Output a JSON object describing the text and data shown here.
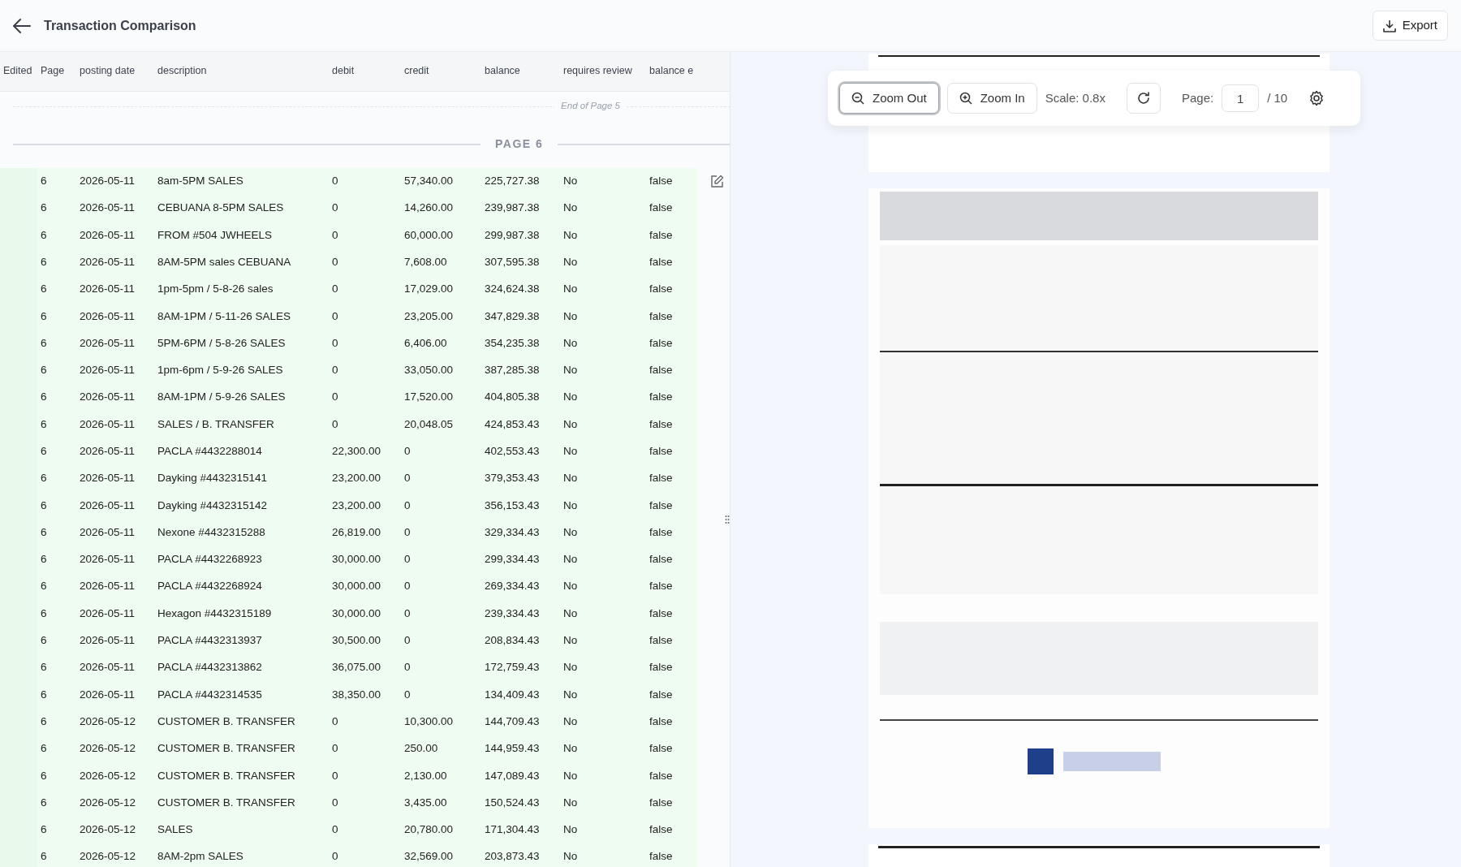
{
  "header": {
    "title": "Transaction Comparison",
    "export_label": "Export"
  },
  "table": {
    "columns": [
      "Edited",
      "Page",
      "posting date",
      "description",
      "debit",
      "credit",
      "balance",
      "requires review",
      "balance e"
    ],
    "end_marker": "End of Page 5",
    "page_divider": "PAGE 6",
    "rows": [
      {
        "page": "6",
        "posting_date": "2026-05-11",
        "description": "8am-5PM SALES",
        "debit": "0",
        "credit": "57,340.00",
        "balance": "225,727.38",
        "requires_review": "No",
        "balance_error": "false",
        "matched": true,
        "hovered": true
      },
      {
        "page": "6",
        "posting_date": "2026-05-11",
        "description": "CEBUANA 8-5PM SALES",
        "debit": "0",
        "credit": "14,260.00",
        "balance": "239,987.38",
        "requires_review": "No",
        "balance_error": "false",
        "matched": true,
        "hovered": false
      },
      {
        "page": "6",
        "posting_date": "2026-05-11",
        "description": "FROM #504 JWHEELS",
        "debit": "0",
        "credit": "60,000.00",
        "balance": "299,987.38",
        "requires_review": "No",
        "balance_error": "false",
        "matched": true,
        "hovered": false
      },
      {
        "page": "6",
        "posting_date": "2026-05-11",
        "description": "8AM-5PM sales CEBUANA",
        "debit": "0",
        "credit": "7,608.00",
        "balance": "307,595.38",
        "requires_review": "No",
        "balance_error": "false",
        "matched": true,
        "hovered": false
      },
      {
        "page": "6",
        "posting_date": "2026-05-11",
        "description": "1pm-5pm / 5-8-26 sales",
        "debit": "0",
        "credit": "17,029.00",
        "balance": "324,624.38",
        "requires_review": "No",
        "balance_error": "false",
        "matched": true,
        "hovered": false
      },
      {
        "page": "6",
        "posting_date": "2026-05-11",
        "description": "8AM-1PM / 5-11-26 SALES",
        "debit": "0",
        "credit": "23,205.00",
        "balance": "347,829.38",
        "requires_review": "No",
        "balance_error": "false",
        "matched": true,
        "hovered": false
      },
      {
        "page": "6",
        "posting_date": "2026-05-11",
        "description": "5PM-6PM / 5-8-26 SALES",
        "debit": "0",
        "credit": "6,406.00",
        "balance": "354,235.38",
        "requires_review": "No",
        "balance_error": "false",
        "matched": true,
        "hovered": false
      },
      {
        "page": "6",
        "posting_date": "2026-05-11",
        "description": "1pm-6pm / 5-9-26 SALES",
        "debit": "0",
        "credit": "33,050.00",
        "balance": "387,285.38",
        "requires_review": "No",
        "balance_error": "false",
        "matched": true,
        "hovered": false
      },
      {
        "page": "6",
        "posting_date": "2026-05-11",
        "description": "8AM-1PM / 5-9-26 SALES",
        "debit": "0",
        "credit": "17,520.00",
        "balance": "404,805.38",
        "requires_review": "No",
        "balance_error": "false",
        "matched": true,
        "hovered": false
      },
      {
        "page": "6",
        "posting_date": "2026-05-11",
        "description": "SALES / B. TRANSFER",
        "debit": "0",
        "credit": "20,048.05",
        "balance": "424,853.43",
        "requires_review": "No",
        "balance_error": "false",
        "matched": true,
        "hovered": false
      },
      {
        "page": "6",
        "posting_date": "2026-05-11",
        "description": "PACLA #4432288014",
        "debit": "22,300.00",
        "credit": "0",
        "balance": "402,553.43",
        "requires_review": "No",
        "balance_error": "false",
        "matched": true,
        "hovered": false
      },
      {
        "page": "6",
        "posting_date": "2026-05-11",
        "description": "Dayking #4432315141",
        "debit": "23,200.00",
        "credit": "0",
        "balance": "379,353.43",
        "requires_review": "No",
        "balance_error": "false",
        "matched": true,
        "hovered": false
      },
      {
        "page": "6",
        "posting_date": "2026-05-11",
        "description": "Dayking #4432315142",
        "debit": "23,200.00",
        "credit": "0",
        "balance": "356,153.43",
        "requires_review": "No",
        "balance_error": "false",
        "matched": true,
        "hovered": false
      },
      {
        "page": "6",
        "posting_date": "2026-05-11",
        "description": "Nexone #4432315288",
        "debit": "26,819.00",
        "credit": "0",
        "balance": "329,334.43",
        "requires_review": "No",
        "balance_error": "false",
        "matched": true,
        "hovered": false
      },
      {
        "page": "6",
        "posting_date": "2026-05-11",
        "description": "PACLA #4432268923",
        "debit": "30,000.00",
        "credit": "0",
        "balance": "299,334.43",
        "requires_review": "No",
        "balance_error": "false",
        "matched": true,
        "hovered": false
      },
      {
        "page": "6",
        "posting_date": "2026-05-11",
        "description": "PACLA #4432268924",
        "debit": "30,000.00",
        "credit": "0",
        "balance": "269,334.43",
        "requires_review": "No",
        "balance_error": "false",
        "matched": true,
        "hovered": false
      },
      {
        "page": "6",
        "posting_date": "2026-05-11",
        "description": "Hexagon #4432315189",
        "debit": "30,000.00",
        "credit": "0",
        "balance": "239,334.43",
        "requires_review": "No",
        "balance_error": "false",
        "matched": true,
        "hovered": false
      },
      {
        "page": "6",
        "posting_date": "2026-05-11",
        "description": "PACLA #4432313937",
        "debit": "30,500.00",
        "credit": "0",
        "balance": "208,834.43",
        "requires_review": "No",
        "balance_error": "false",
        "matched": true,
        "hovered": false
      },
      {
        "page": "6",
        "posting_date": "2026-05-11",
        "description": "PACLA #4432313862",
        "debit": "36,075.00",
        "credit": "0",
        "balance": "172,759.43",
        "requires_review": "No",
        "balance_error": "false",
        "matched": true,
        "hovered": false
      },
      {
        "page": "6",
        "posting_date": "2026-05-11",
        "description": "PACLA #4432314535",
        "debit": "38,350.00",
        "credit": "0",
        "balance": "134,409.43",
        "requires_review": "No",
        "balance_error": "false",
        "matched": true,
        "hovered": false
      },
      {
        "page": "6",
        "posting_date": "2026-05-12",
        "description": "CUSTOMER B. TRANSFER",
        "debit": "0",
        "credit": "10,300.00",
        "balance": "144,709.43",
        "requires_review": "No",
        "balance_error": "false",
        "matched": true,
        "hovered": false
      },
      {
        "page": "6",
        "posting_date": "2026-05-12",
        "description": "CUSTOMER B. TRANSFER",
        "debit": "0",
        "credit": "250.00",
        "balance": "144,959.43",
        "requires_review": "No",
        "balance_error": "false",
        "matched": true,
        "hovered": false
      },
      {
        "page": "6",
        "posting_date": "2026-05-12",
        "description": "CUSTOMER B. TRANSFER",
        "debit": "0",
        "credit": "2,130.00",
        "balance": "147,089.43",
        "requires_review": "No",
        "balance_error": "false",
        "matched": true,
        "hovered": false
      },
      {
        "page": "6",
        "posting_date": "2026-05-12",
        "description": "CUSTOMER B. TRANSFER",
        "debit": "0",
        "credit": "3,435.00",
        "balance": "150,524.43",
        "requires_review": "No",
        "balance_error": "false",
        "matched": true,
        "hovered": false
      },
      {
        "page": "6",
        "posting_date": "2026-05-12",
        "description": "SALES",
        "debit": "0",
        "credit": "20,780.00",
        "balance": "171,304.43",
        "requires_review": "No",
        "balance_error": "false",
        "matched": true,
        "hovered": false
      },
      {
        "page": "6",
        "posting_date": "2026-05-12",
        "description": "8AM-2pm SALES",
        "debit": "0",
        "credit": "32,569.00",
        "balance": "203,873.43",
        "requires_review": "No",
        "balance_error": "false",
        "matched": true,
        "hovered": false
      }
    ]
  },
  "viewer": {
    "toolbar": {
      "zoom_out_label": "Zoom Out",
      "zoom_out_focused": true,
      "zoom_in_label": "Zoom In",
      "scale": "Scale: 0.8x",
      "page_label": "Page:",
      "page_value": "1",
      "page_total": "/ 10"
    }
  }
}
